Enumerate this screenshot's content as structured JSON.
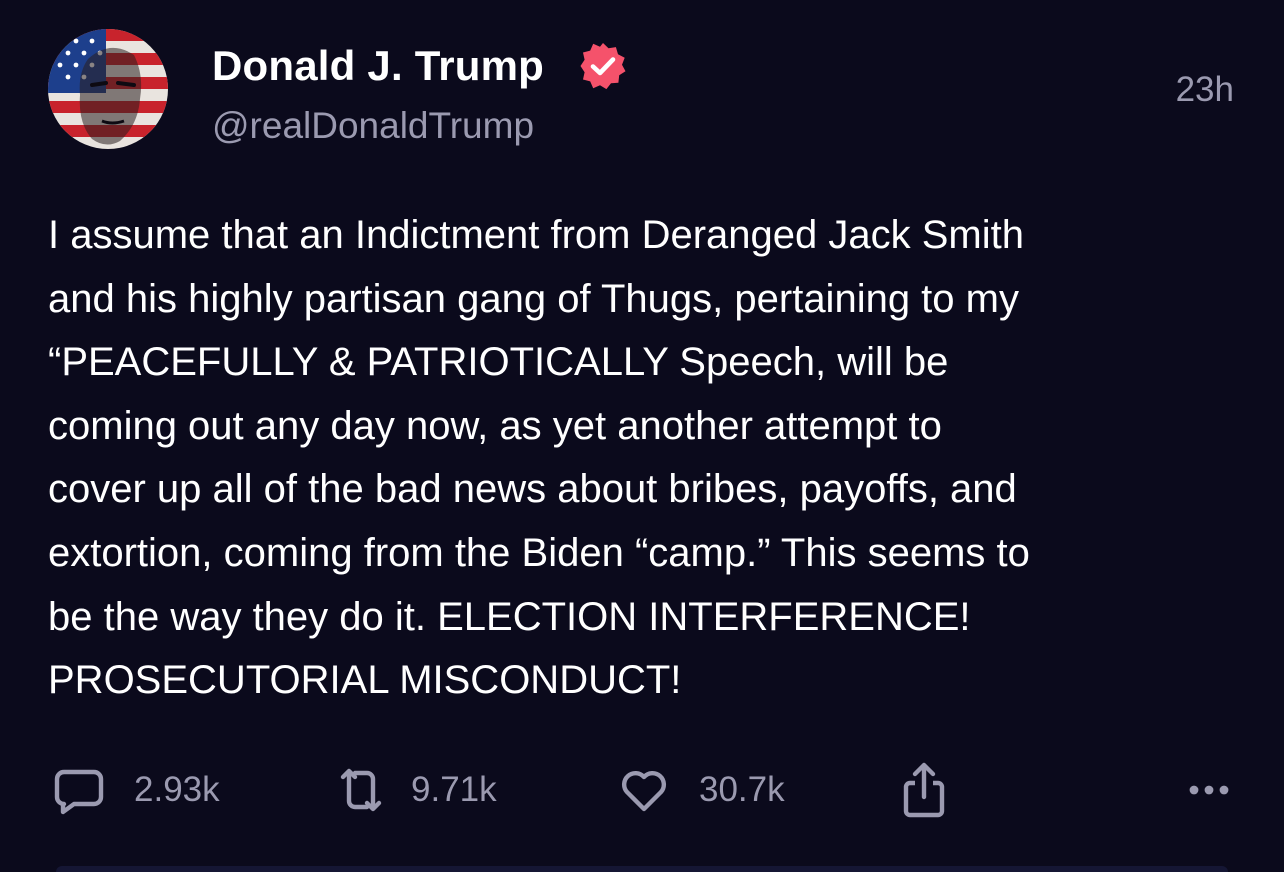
{
  "post": {
    "author": {
      "display_name": "Donald J. Trump",
      "handle": "@realDonaldTrump",
      "verified": true,
      "avatar_icon": "flag-portrait-avatar"
    },
    "timestamp": "23h",
    "text_lines": [
      "I assume that an Indictment from Deranged Jack Smith",
      "and his highly partisan gang of Thugs, pertaining to my",
      "“PEACEFULLY & PATRIOTICALLY Speech, will be",
      "coming out any day now, as yet another attempt to",
      "cover up all of the bad news about bribes, payoffs, and",
      "extortion, coming from the Biden “camp.” This seems to",
      "be the way they do it. ELECTION INTERFERENCE!",
      "PROSECUTORIAL MISCONDUCT!"
    ],
    "stats": {
      "replies": "2.93k",
      "reposts": "9.71k",
      "likes": "30.7k"
    },
    "icons": {
      "reply": "reply-icon",
      "repost": "repost-icon",
      "like": "heart-icon",
      "share": "share-icon",
      "more": "more-options-icon",
      "verified": "verified-badge-icon"
    },
    "colors": {
      "background": "#0b0a1c",
      "text": "#ffffff",
      "muted": "#9b9ab0",
      "verified_badge": "#f5526b"
    }
  }
}
